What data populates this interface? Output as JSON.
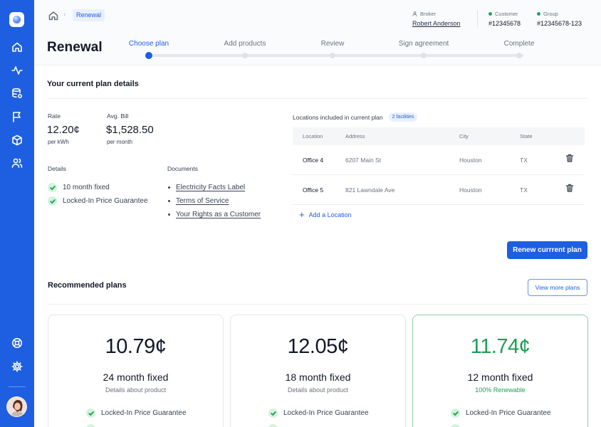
{
  "breadcrumb": {
    "current": "Renewal"
  },
  "page": {
    "title": "Renewal"
  },
  "header_meta": {
    "broker_label": "Broker",
    "broker_name": "Robert Anderson",
    "customer_label": "Customer",
    "customer_id": "#12345678",
    "group_label": "Group",
    "group_id": "#12345678-123",
    "status_color": "#22a55a"
  },
  "stepper": {
    "steps": [
      "Choose plan",
      "Add products",
      "Review",
      "Sign agreement",
      "Complete"
    ],
    "active_index": 0
  },
  "current_plan": {
    "title": "Your current plan details",
    "rate_label": "Rate",
    "rate_value": "12.20¢",
    "rate_unit": "per kWh",
    "bill_label": "Avg. Bill",
    "bill_value": "$1,528.50",
    "bill_unit": "per month",
    "details_label": "Details",
    "details": [
      "10 month fixed",
      "Locked-In Price Guarantee"
    ],
    "documents_label": "Documents",
    "documents": [
      "Electricity Facts Label",
      "Terms of Service",
      "Your Rights as a Customer"
    ]
  },
  "locations": {
    "heading": "Locations included in current plan",
    "badge": "2 facilities",
    "columns": [
      "Location",
      "Address",
      "City",
      "State"
    ],
    "rows": [
      {
        "location": "Office 4",
        "address": "6207 Main St",
        "city": "Houston",
        "state": "TX"
      },
      {
        "location": "Office 5",
        "address": "821 Lawndale Ave",
        "city": "Houston",
        "state": "TX"
      }
    ],
    "add_label": "Add a Location"
  },
  "actions": {
    "renew_label": "Renew currrent plan",
    "view_more_label": "View more plans"
  },
  "recommended": {
    "title": "Recommended plans",
    "plans": [
      {
        "price": "10.79¢",
        "term": "24 month fixed",
        "desc": "Details about product",
        "feature": "Locked-In Price Guarantee"
      },
      {
        "price": "12.05¢",
        "term": "18 month fixed",
        "desc": "Details about product",
        "feature": "Locked-In Price Guarantee"
      },
      {
        "price": "11.74¢",
        "term": "12 month fixed",
        "desc": "100% Renewable",
        "feature": "Locked-In Price Guarantee"
      }
    ]
  },
  "colors": {
    "brand": "#1d5fe0",
    "success": "#1f9d55"
  },
  "icons": {
    "sidebar": [
      "home-icon",
      "activity-icon",
      "database-icon",
      "flag-icon",
      "box-icon",
      "users-icon",
      "help-icon",
      "settings-icon"
    ]
  }
}
